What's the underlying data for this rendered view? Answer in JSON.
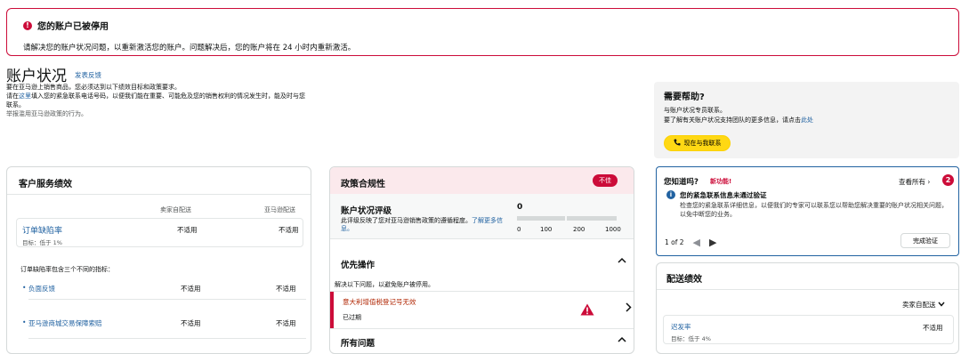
{
  "alert": {
    "title": "您的账户已被停用",
    "message": "请解决您的账户状况问题，以重新激活您的账户。问题解决后，您的账户将在 24 小时内重新激活。",
    "icon": "error-icon"
  },
  "header": {
    "title": "账户状况",
    "feedback": "发表反馈",
    "intro_line1": "要在亚马逊上销售商品，您必须达到以下绩效目标和政策要求。",
    "intro_line2_pre": "请在",
    "intro_line2_link": "这里",
    "intro_line2_post": "填入您的紧急联系电话号码，以便我们能在重要、可能危及您的销售权利的情况发生时，能及时与您联系。",
    "intro_line3": "举报滥用亚马逊政策的行为。"
  },
  "help": {
    "title": "需要帮助?",
    "line1": "与账户状况专员联系。",
    "line2_pre": "要了解有关账户状况支持团队的更多信息，请点击",
    "line2_link": "此处",
    "button": "现在与我联系",
    "button_icon": "phone-icon"
  },
  "customer_service": {
    "title": "客户服务绩效",
    "col_seller": "卖家自配送",
    "col_amazon": "亚马逊配送",
    "odr": {
      "name": "订单缺陷率",
      "target": "目标：低于 1%",
      "seller": "不适用",
      "amazon": "不适用"
    },
    "note": "订单缺陷率包含三个不同的指标：",
    "metrics": [
      {
        "name": "负面反馈",
        "seller": "不适用",
        "amazon": "不适用"
      },
      {
        "name": "亚马逊商城交易保障索赔",
        "seller": "不适用",
        "amazon": "不适用"
      }
    ]
  },
  "policy": {
    "title": "政策合规性",
    "badge": "不佳",
    "rating_title": "账户状况评级",
    "rating_desc": "此评级反映了您对亚马逊销售政策的遵循程度。",
    "rating_link": "了解更多信息。",
    "rating_value": "0",
    "scale": [
      "0",
      "100",
      "200",
      "1000"
    ],
    "priority_title": "优先操作",
    "priority_desc": "解决以下问题，以避免账户被停用。",
    "issue_title": "意大利增值税登记号无效",
    "issue_status": "已过期",
    "all_issues_title": "所有问题"
  },
  "did_you_know": {
    "title": "您知道吗?",
    "new_label": "新功能!",
    "view_all": "查看所有",
    "count": "2",
    "msg_title": "您的紧急联系信息未通过验证",
    "msg_body": "检查您的紧急联系详细信息，以便我们的专家可以联系您以帮助您解决重要的账户状况相关问题，以免中断您的业务。",
    "pager": "1 of 2",
    "button": "完成验证"
  },
  "delivery": {
    "title": "配送绩效",
    "select_value": "卖家自配送",
    "metric_name": "迟发率",
    "metric_target": "目标：低于 4%",
    "metric_value": "不适用"
  },
  "colors": {
    "alert_red": "#cc0c39",
    "link_blue": "#2162a1",
    "help_yellow": "#ffd814",
    "policy_pink": "#fbe9ec"
  }
}
